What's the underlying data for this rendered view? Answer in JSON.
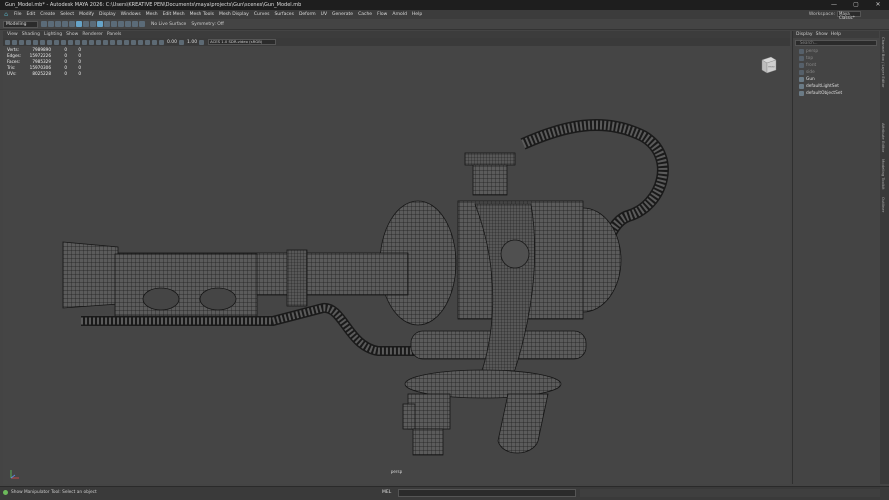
{
  "window": {
    "title": "Gun_Model.mb* - Autodesk MAYA 2026: C:\\Users\\KREATIVE PEN\\Documents\\maya\\projects\\Gun\\scenes\\Gun_Model.mb",
    "min": "—",
    "max": "▢",
    "close": "✕"
  },
  "menus": [
    "File",
    "Edit",
    "Create",
    "Select",
    "Modify",
    "Display",
    "Windows",
    "Mesh",
    "Edit Mesh",
    "Mesh Tools",
    "Mesh Display",
    "Curves",
    "Surfaces",
    "Deform",
    "UV",
    "Generate",
    "Cache",
    "Flow",
    "Arnold",
    "Help"
  ],
  "workspace": {
    "label": "Workspace:",
    "value": "Maya Classic*"
  },
  "statusline": {
    "mode": "Modeling",
    "live_surface": "No Live Surface",
    "symmetry": "Symmetry: Off"
  },
  "viewport": {
    "menu": [
      "View",
      "Shading",
      "Lighting",
      "Show",
      "Renderer",
      "Panels"
    ],
    "field1": "0.00",
    "field2": "1.00",
    "color_space": "ACES 1.0 SDR-video (sRGB)",
    "camera": "persp",
    "viewcube_label": "FRONT",
    "hud": [
      [
        "Verts:",
        "7989890",
        "0",
        "0"
      ],
      [
        "Edges:",
        "15972226",
        "0",
        "0"
      ],
      [
        "Faces:",
        "7985329",
        "0",
        "0"
      ],
      [
        "Tris:",
        "15970306",
        "0",
        "0"
      ],
      [
        "UVs:",
        "8025228",
        "0",
        "0"
      ]
    ]
  },
  "outliner": {
    "menu": [
      "Display",
      "Show",
      "Help"
    ],
    "search": "Search...",
    "items": [
      {
        "label": "persp",
        "dim": true
      },
      {
        "label": "top",
        "dim": true
      },
      {
        "label": "front",
        "dim": true
      },
      {
        "label": "side",
        "dim": true
      },
      {
        "label": "Gun",
        "dim": false
      },
      {
        "label": "defaultLightSet",
        "dim": false
      },
      {
        "label": "defaultObjectSet",
        "dim": false
      }
    ]
  },
  "side_tabs": [
    "Channel Box / Layer Editor",
    "Attribute Editor",
    "Modeling Toolkit",
    "Outliner"
  ],
  "bottom": {
    "help": "Show Manipulator Tool: Select an object",
    "mel": "MEL"
  },
  "colors": {
    "bg": "#454545",
    "mesh": "#5b5b5b",
    "wire": "#1a1a1a",
    "accent": "#66a3c8"
  }
}
